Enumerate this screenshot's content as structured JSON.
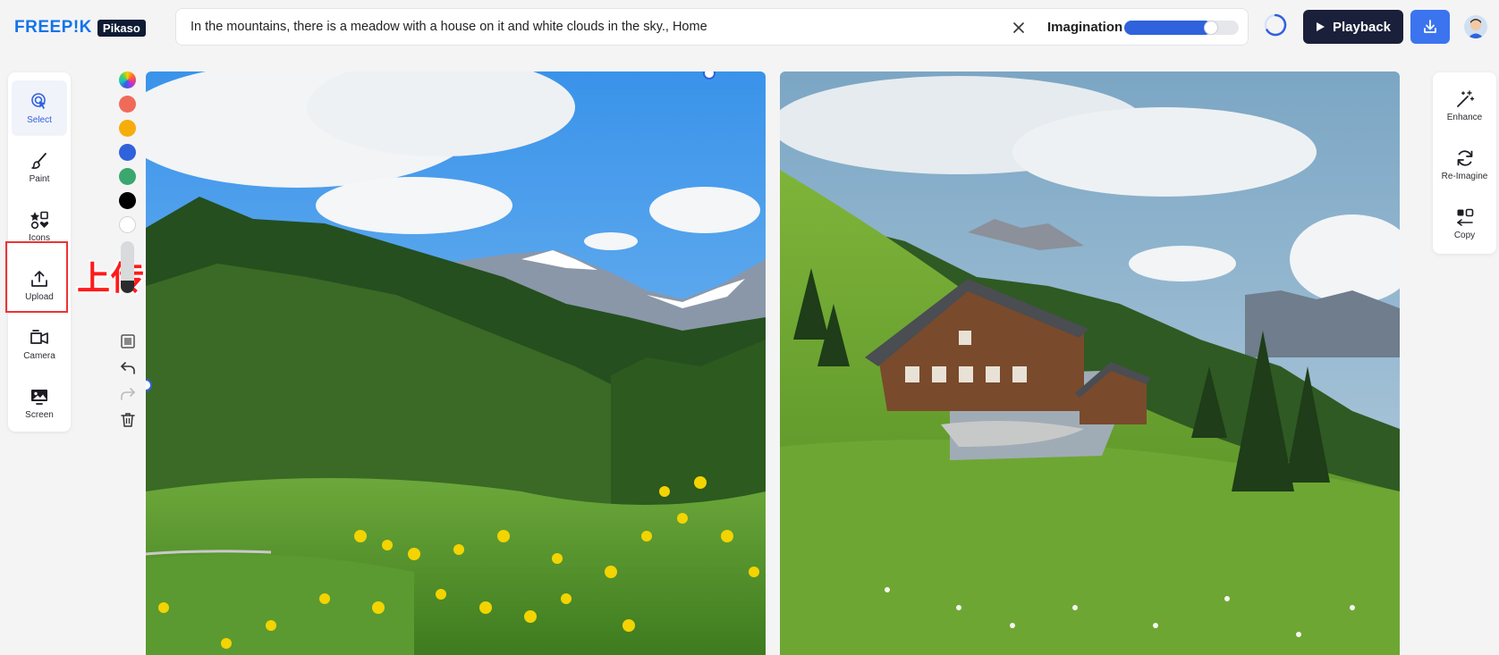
{
  "brand": {
    "logo": "FREEP!K",
    "product": "Pikaso"
  },
  "prompt": {
    "text": "In the mountains, there is a meadow with a house on it and white clouds in the sky., Home"
  },
  "imagination": {
    "label": "Imagination",
    "value": 0.72
  },
  "header": {
    "playback_label": "Playback"
  },
  "tools": [
    {
      "id": "select",
      "label": "Select",
      "icon": "select-pointer-icon",
      "active": true
    },
    {
      "id": "paint",
      "label": "Paint",
      "icon": "paintbrush-icon"
    },
    {
      "id": "icons",
      "label": "Icons",
      "icon": "shapes-icon"
    },
    {
      "id": "upload",
      "label": "Upload",
      "icon": "upload-icon"
    },
    {
      "id": "camera",
      "label": "Camera",
      "icon": "camera-icon"
    },
    {
      "id": "screen",
      "label": "Screen",
      "icon": "screen-image-icon"
    }
  ],
  "annotation": {
    "text": "上传参考图"
  },
  "palette": {
    "colors": [
      "#f06a5a",
      "#f6ad0b",
      "#2f62db",
      "#3aa76d",
      "#000000",
      "#ffffff"
    ]
  },
  "right_tools": [
    {
      "id": "enhance",
      "label": "Enhance",
      "icon": "magic-wand-icon"
    },
    {
      "id": "reimagine",
      "label": "Re-Imagine",
      "icon": "refresh-icon"
    },
    {
      "id": "copy",
      "label": "Copy",
      "icon": "copy-layout-icon"
    }
  ]
}
